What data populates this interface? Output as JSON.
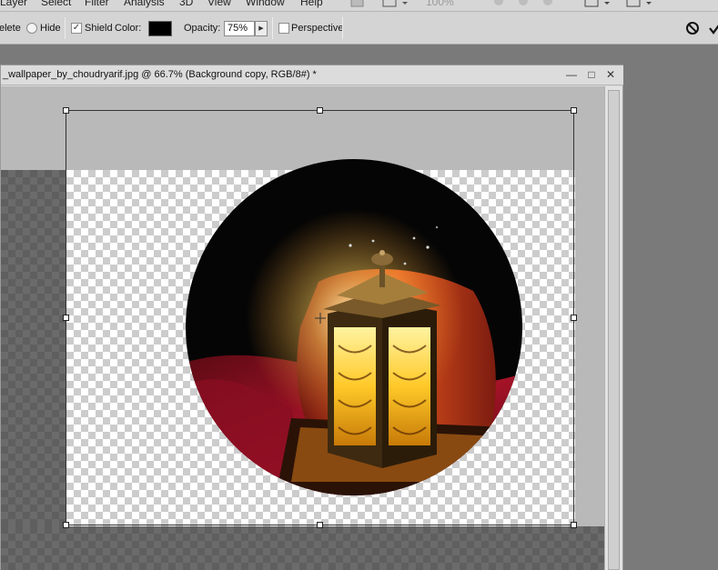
{
  "menubar": {
    "items": [
      {
        "label": "Layer",
        "name": "menu-layer"
      },
      {
        "label": "Select",
        "name": "menu-select"
      },
      {
        "label": "Filter",
        "name": "menu-filter"
      },
      {
        "label": "Analysis",
        "name": "menu-analysis"
      },
      {
        "label": "3D",
        "name": "menu-3d"
      },
      {
        "label": "View",
        "name": "menu-view"
      },
      {
        "label": "Window",
        "name": "menu-window"
      },
      {
        "label": "Help",
        "name": "menu-help"
      }
    ],
    "zoom_label": "100%"
  },
  "options": {
    "delete_label": "elete",
    "hide_label": "Hide",
    "shield_label": "Shield",
    "shield_checked": true,
    "color_label": "Color:",
    "shield_color": "#000000",
    "opacity_label": "Opacity:",
    "opacity_value": "75%",
    "perspective_label": "Perspective",
    "perspective_checked": false,
    "icons": {
      "cancel": "cancel-transform-icon",
      "commit": "commit-transform-icon"
    }
  },
  "document": {
    "title": "_wallpaper_by_choudryarif.jpg @ 66.7% (Background copy, RGB/8#) *",
    "buttons": {
      "minimize": "—",
      "maximize": "□",
      "close": "✕"
    }
  },
  "colors": {
    "panel": "#d4d4d4",
    "pasteboard": "#b9b9b9",
    "workspace": "#7a7a7a",
    "lantern_glow": "#ffd23a",
    "cloth": "#c8102e"
  }
}
